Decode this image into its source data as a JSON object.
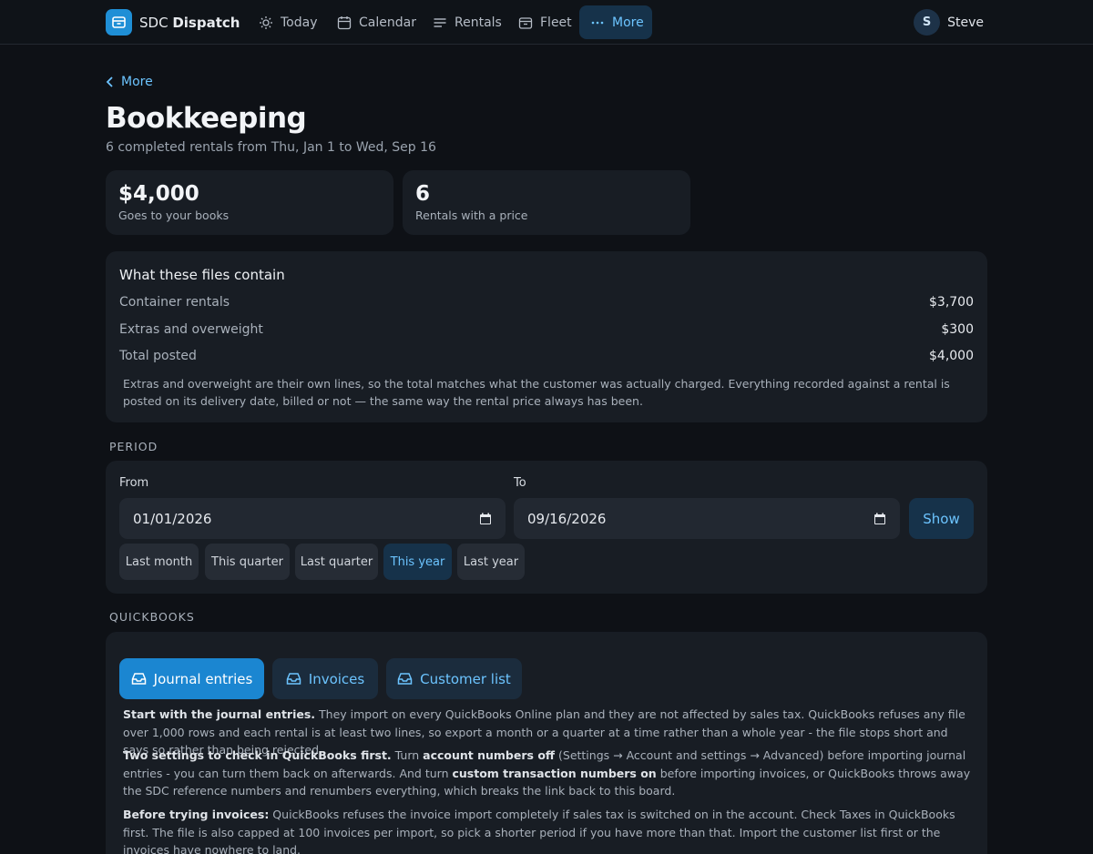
{
  "nav": {
    "brand_prefix": "SDC",
    "brand_name": "Dispatch",
    "items": [
      {
        "label": "Today",
        "icon": "sun-icon"
      },
      {
        "label": "Calendar",
        "icon": "calendar-icon"
      },
      {
        "label": "Rentals",
        "icon": "list-icon"
      },
      {
        "label": "Fleet",
        "icon": "container-icon"
      },
      {
        "label": "More",
        "icon": "ellipsis-icon",
        "active": true
      }
    ],
    "user_initial": "S",
    "user_name": "Steve"
  },
  "header": {
    "back_label": "More",
    "title": "Bookkeeping",
    "subtitle": "6 completed rentals from Thu, Jan 1 to Wed, Sep 16"
  },
  "stats": [
    {
      "value": "$4,000",
      "label": "Goes to your books"
    },
    {
      "value": "6",
      "label": "Rentals with a price"
    }
  ],
  "contents": {
    "title": "What these files contain",
    "rows": [
      {
        "label": "Container rentals",
        "value": "$3,700"
      },
      {
        "label": "Extras and overweight",
        "value": "$300"
      },
      {
        "label": "Total posted",
        "value": "$4,000"
      }
    ],
    "note": "Extras and overweight are their own lines, so the total matches what the customer was actually charged. Everything recorded against a rental is posted on its delivery date, billed or not — the same way the rental price always has been."
  },
  "period": {
    "section_label": "PERIOD",
    "from_label": "From",
    "from_value": "01/01/2026",
    "to_label": "To",
    "to_value": "09/16/2026",
    "show_label": "Show",
    "presets": [
      {
        "label": "Last month"
      },
      {
        "label": "This quarter"
      },
      {
        "label": "Last quarter"
      },
      {
        "label": "This year",
        "active": true
      },
      {
        "label": "Last year"
      }
    ]
  },
  "quickbooks": {
    "section_label": "QUICKBOOKS",
    "buttons": [
      {
        "label": "Journal entries",
        "style": "primary"
      },
      {
        "label": "Invoices",
        "style": "secondary"
      },
      {
        "label": "Customer list",
        "style": "secondary"
      }
    ],
    "p1_bold": "Start with the journal entries.",
    "p1_rest": " They import on every QuickBooks Online plan and they are not affected by sales tax. QuickBooks refuses any file over 1,000 rows and each rental is at least two lines, so export a month or a quarter at a time rather than a whole year - the file stops short and says so rather than being rejected.",
    "p2_bold": "Two settings to check in QuickBooks first.",
    "p2_a": " Turn ",
    "p2_bold2": "account numbers off",
    "p2_b": " (Settings → Account and settings → Advanced) before importing journal entries - you can turn them back on afterwards. And turn ",
    "p2_bold3": "custom transaction numbers on",
    "p2_c": " before importing invoices, or QuickBooks throws away the SDC reference numbers and renumbers everything, which breaks the link back to this board.",
    "p3_bold": "Before trying invoices:",
    "p3_rest": " QuickBooks refuses the invoice import completely if sales tax is switched on in the account. Check Taxes in QuickBooks first. The file is also capped at 100 invoices per import, so pick a shorter period if you have more than that. Import the customer list first or the invoices have nowhere to land."
  },
  "colors": {
    "background": "#0e1116",
    "panel": "#181d24",
    "accent": "#6cc4ff",
    "primary_button": "#1b86d1"
  }
}
